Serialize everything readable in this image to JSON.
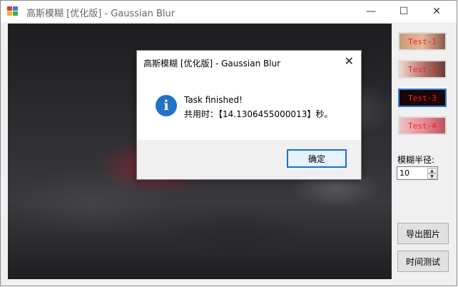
{
  "window": {
    "title": "高斯模糊 [优化版] - Gaussian Blur",
    "minimize_glyph": "—",
    "maximize_glyph": "☐",
    "close_glyph": "✕"
  },
  "thumbnails": [
    {
      "label": "Test-1"
    },
    {
      "label": "Test-2"
    },
    {
      "label": "Test-3",
      "selected": true
    },
    {
      "label": "Test-4"
    }
  ],
  "controls": {
    "radius_label": "模糊半径:",
    "radius_value": "10",
    "export_button": "导出图片",
    "timing_button": "时间测试"
  },
  "dialog": {
    "title": "高斯模糊 [优化版] - Gaussian Blur",
    "close_glyph": "✕",
    "icon_glyph": "i",
    "message_line1": "Task finished!",
    "message_line2": "共用时：【14.1306455000013】秒。",
    "ok_button": "确定"
  },
  "colors": {
    "accent": "#1e6ec8",
    "thumb_text": "#ff2020"
  }
}
